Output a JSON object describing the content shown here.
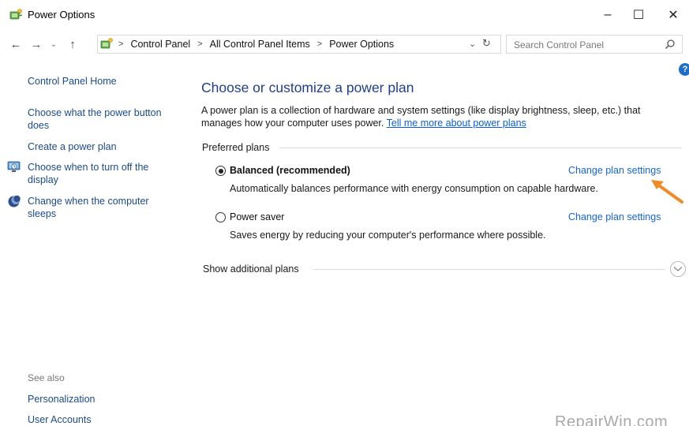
{
  "window": {
    "title": "Power Options",
    "icon": "power-options-icon",
    "controls": {
      "minimize": "–",
      "maximize": "☐",
      "close": "✕"
    }
  },
  "nav": {
    "back": "←",
    "forward": "→",
    "recent": "⌄",
    "up": "↑",
    "breadcrumbs": [
      "Control Panel",
      "All Control Panel Items",
      "Power Options"
    ],
    "separator": ">",
    "dropdown": "⌄",
    "refresh": "↻"
  },
  "search": {
    "placeholder": "Search Control Panel"
  },
  "help": {
    "label": "?"
  },
  "sidebar": {
    "home": "Control Panel Home",
    "items": [
      {
        "label": "Choose what the power button does"
      },
      {
        "label": "Create a power plan"
      },
      {
        "label": "Choose when to turn off the display",
        "icon": "display-icon"
      },
      {
        "label": "Change when the computer sleeps",
        "icon": "moon-icon"
      }
    ],
    "see_also": "See also",
    "see_also_links": [
      "Personalization",
      "User Accounts"
    ]
  },
  "main": {
    "heading": "Choose or customize a power plan",
    "description": "A power plan is a collection of hardware and system settings (like display brightness, sleep, etc.) that manages how your computer uses power.",
    "description_link": "Tell me more about power plans",
    "preferred_label": "Preferred plans",
    "plans": [
      {
        "name": "Balanced (recommended)",
        "description": "Automatically balances performance with energy consumption on capable hardware.",
        "selected": true,
        "action": "Change plan settings"
      },
      {
        "name": "Power saver",
        "description": "Saves energy by reducing your computer's performance where possible.",
        "selected": false,
        "action": "Change plan settings"
      }
    ],
    "show_additional": "Show additional plans"
  },
  "annotation": {
    "arrow_color": "#f08a24"
  },
  "watermark": "RepairWin.com",
  "colors": {
    "link": "#1a4a8c",
    "heading": "#1e3f8f",
    "action_link": "#1565d8"
  }
}
